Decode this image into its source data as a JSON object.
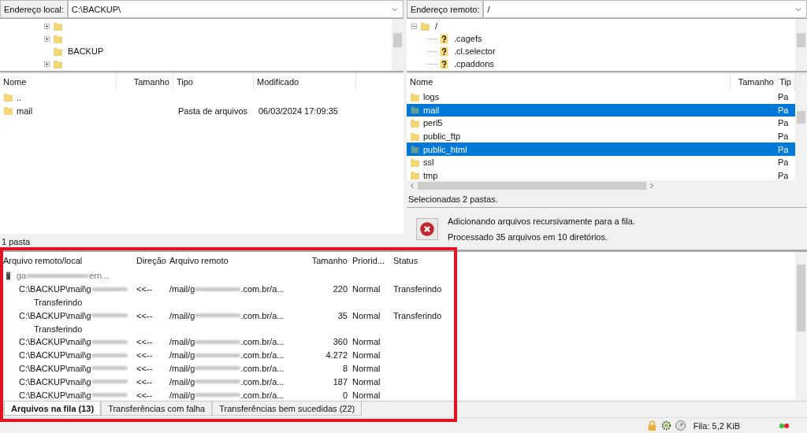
{
  "local": {
    "address_label": "Endereço local:",
    "address": "C:\\BACKUP\\",
    "tree": [
      {
        "expandable": true
      },
      {
        "expandable": true
      },
      {
        "label": "BACKUP",
        "expandable": false
      },
      {
        "expandable": true
      }
    ],
    "columns": [
      "Nome",
      "Tamanho",
      "Tipo",
      "Modificado"
    ],
    "files": [
      {
        "name": ".."
      },
      {
        "name": "mail",
        "type": "Pasta de arquivos",
        "modified": "06/03/2024 17:09:35"
      }
    ],
    "status": "1 pasta"
  },
  "remote": {
    "address_label": "Endereço remoto:",
    "address": "/",
    "tree": [
      {
        "label": "/",
        "expanded": true,
        "children": [
          {
            "label": ".cagefs",
            "kind": "unknown"
          },
          {
            "label": ".cl.selector",
            "kind": "unknown"
          },
          {
            "label": ".cpaddons",
            "kind": "unknown"
          }
        ]
      }
    ],
    "columns": [
      "Nome",
      "Tamanho",
      "Tip"
    ],
    "files": [
      {
        "name": "logs",
        "type": "Pa",
        "selected": false
      },
      {
        "name": "mail",
        "type": "Pa",
        "selected": true
      },
      {
        "name": "perl5",
        "type": "Pa",
        "selected": false
      },
      {
        "name": "public_ftp",
        "type": "Pa",
        "selected": false
      },
      {
        "name": "public_html",
        "type": "Pa",
        "selected": true
      },
      {
        "name": "ssl",
        "type": "Pa",
        "selected": false
      },
      {
        "name": "tmp",
        "type": "Pa",
        "selected": false
      }
    ],
    "status": "Selecionadas 2 pastas."
  },
  "messages": {
    "kind": "error",
    "lines": [
      "Adicionando arquivos recursivamente para a fila.",
      "Processado 35 arquivos em 10 diretórios."
    ]
  },
  "queue": {
    "columns": [
      "Arquivo remoto/local",
      "Direção",
      "Arquivo remoto",
      "Tamanho",
      "Priorid...",
      "Status"
    ],
    "server": {
      "name_prefix": "ga",
      "name_suffix": "ern..."
    },
    "rows": [
      {
        "local_prefix": "C:\\BACKUP\\mail\\g",
        "direction": "<<--",
        "remote_prefix": "/mail/g",
        "remote_suffix": ".com.br/a...",
        "size": "220",
        "priority": "Normal",
        "status": "Transferindo",
        "substatus": "Transferindo"
      },
      {
        "local_prefix": "C:\\BACKUP\\mail\\g",
        "direction": "<<--",
        "remote_prefix": "/mail/g",
        "remote_suffix": ".com.br/a...",
        "size": "35",
        "priority": "Normal",
        "status": "Transferindo",
        "substatus": "Transferindo"
      },
      {
        "local_prefix": "C:\\BACKUP\\mail\\g",
        "direction": "<<--",
        "remote_prefix": "/mail/g",
        "remote_suffix": ".com.br/a...",
        "size": "360",
        "priority": "Normal"
      },
      {
        "local_prefix": "C:\\BACKUP\\mail\\g",
        "direction": "<<--",
        "remote_prefix": "/mail/g",
        "remote_suffix": ".com.br/a...",
        "size": "4.272",
        "priority": "Normal"
      },
      {
        "local_prefix": "C:\\BACKUP\\mail\\g",
        "direction": "<<--",
        "remote_prefix": "/mail/g",
        "remote_suffix": ".com.br/a...",
        "size": "8",
        "priority": "Normal"
      },
      {
        "local_prefix": "C:\\BACKUP\\mail\\g",
        "direction": "<<--",
        "remote_prefix": "/mail/g",
        "remote_suffix": ".com.br/a...",
        "size": "187",
        "priority": "Normal"
      },
      {
        "local_prefix": "C:\\BACKUP\\mail\\g",
        "direction": "<<--",
        "remote_prefix": "/mail/g",
        "remote_suffix": ".com.br/a...",
        "size": "0",
        "priority": "Normal"
      }
    ],
    "tabs": [
      {
        "label": "Arquivos na fila (13)",
        "selected": true
      },
      {
        "label": "Transferências com falha",
        "selected": false
      },
      {
        "label": "Transferências bem sucedidas (22)",
        "selected": false
      }
    ]
  },
  "status_bar": {
    "queue": "Fila: 5,2 KiB"
  }
}
